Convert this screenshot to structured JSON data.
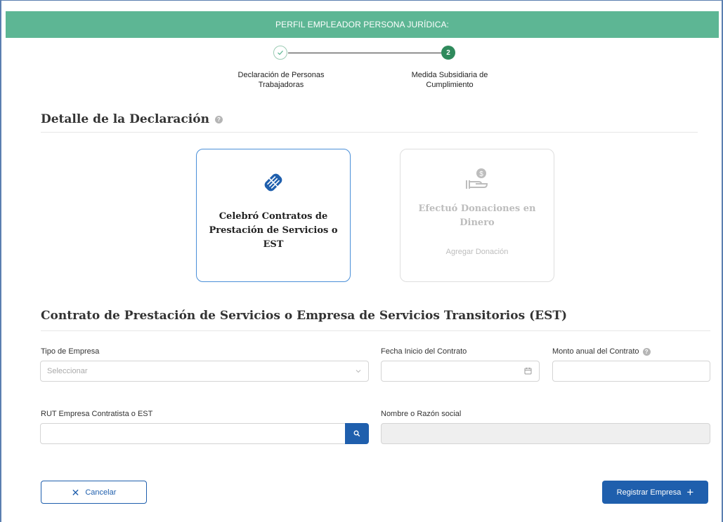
{
  "header": {
    "title": "PERFIL EMPLEADOR PERSONA JURÍDICA:"
  },
  "stepper": {
    "steps": [
      {
        "number": "",
        "label": "Declaración de Personas Trabajadoras",
        "state": "completed"
      },
      {
        "number": "2",
        "label": "Medida Subsidiaria de Cumplimiento",
        "state": "active"
      }
    ]
  },
  "declaration": {
    "title": "Detalle de la Declaración",
    "help_icon": "question-icon",
    "cards": [
      {
        "title": "Celebró Contratos de Prestación de Servicios o EST",
        "icon": "handshake-icon",
        "state": "selected"
      },
      {
        "title": "Efectuó Donaciones en Dinero",
        "icon": "hand-money-icon",
        "link": "Agregar Donación",
        "state": "disabled"
      }
    ]
  },
  "contract": {
    "title": "Contrato de Prestación de Servicios o Empresa de Servicios Transitorios (EST)",
    "fields": {
      "tipo_empresa": {
        "label": "Tipo de Empresa",
        "placeholder": "Seleccionar",
        "value": ""
      },
      "fecha_inicio": {
        "label": "Fecha Inicio del Contrato",
        "value": ""
      },
      "monto_anual": {
        "label": "Monto anual del Contrato",
        "value": ""
      },
      "rut": {
        "label": "RUT Empresa Contratista o EST",
        "value": ""
      },
      "razon_social": {
        "label": "Nombre o Razón social",
        "value": ""
      }
    }
  },
  "actions": {
    "cancel_label": "Cancelar",
    "register_label": "Registrar Empresa"
  },
  "colors": {
    "header_green": "#5db694",
    "step_active": "#2f8a5c",
    "primary_blue": "#1f5fad",
    "card_border_active": "#4a8fd8"
  }
}
